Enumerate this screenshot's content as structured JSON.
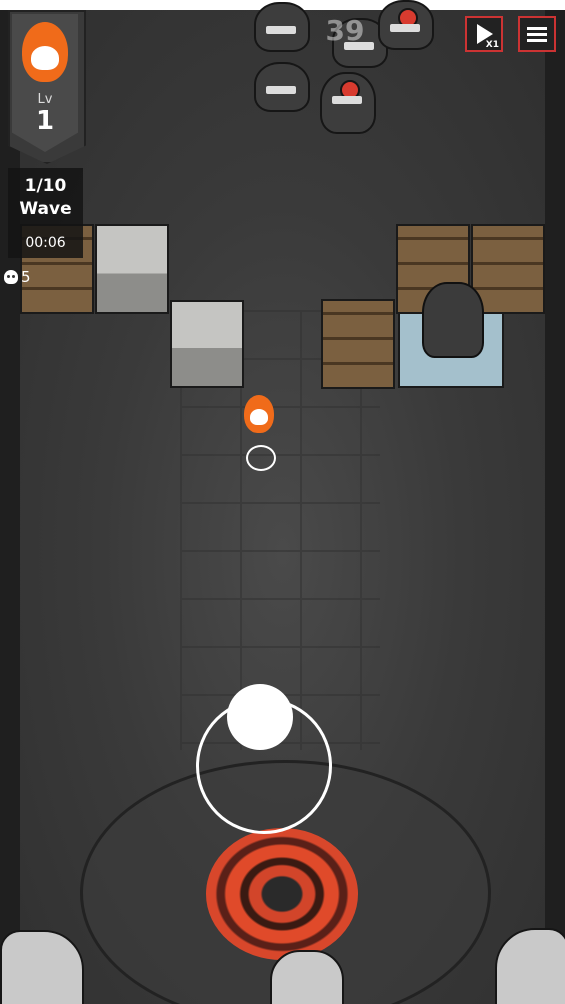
{
  "hud": {
    "level_label": "Lv",
    "level_value": "1",
    "wave_count": "1/10",
    "wave_label": "Wave",
    "timer": "00:06",
    "kill_count": "5",
    "center_counter": "39",
    "speed_label": "X1"
  },
  "icons": {
    "avatar": "flaming-skull-icon",
    "kills": "skull-icon",
    "play": "play-icon",
    "menu": "menu-icon"
  },
  "colors": {
    "button_border": "#cc3333",
    "flame": "#f06b1a",
    "portal": "#d8472b",
    "enemy_eye": "#d83b2f"
  }
}
